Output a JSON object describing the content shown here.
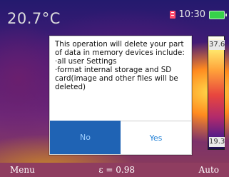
{
  "header": {
    "temperature": "20.7°C",
    "time": "10:30",
    "sd_icon": "sd-card-icon",
    "battery_icon": "battery-icon"
  },
  "scale": {
    "max": "37.6",
    "min": "19.3"
  },
  "dialog": {
    "message": "This operation will delete your part of data in memory devices include:\n·all user Settings\n·format internal storage and SD card(image and other files will be deleted)",
    "no_label": "No",
    "yes_label": "Yes"
  },
  "bottom": {
    "menu_label": "Menu",
    "emissivity": "ε = 0.98",
    "auto_label": "Auto"
  },
  "colors": {
    "no_button": "#1f63b4",
    "yes_text": "#1f7fd6",
    "battery": "#37d24a",
    "sd_card": "#ff4d6d"
  }
}
